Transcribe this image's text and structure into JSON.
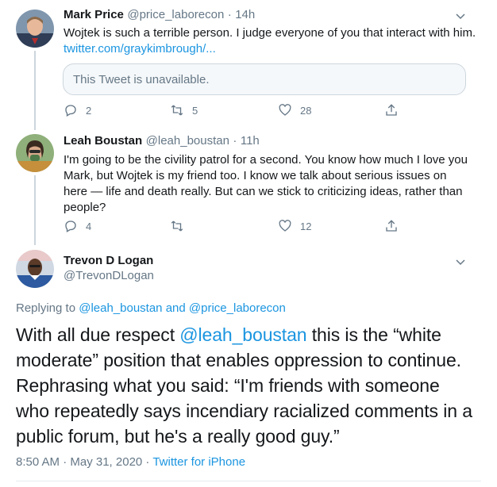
{
  "tweets": [
    {
      "name": "Mark Price",
      "handle": "@price_laborecon",
      "sep": "·",
      "time": "14h",
      "text": "Wojtek is such a terrible person. I judge everyone of you that interact with him.",
      "link": "twitter.com/graykimbrough/...",
      "quote_notice": "This Tweet is unavailable.",
      "replies": "2",
      "retweets": "5",
      "likes": "28"
    },
    {
      "name": "Leah Boustan",
      "handle": "@leah_boustan",
      "sep": "·",
      "time": "11h",
      "text": "I'm going to be the civility patrol for a second. You know how much I love you Mark, but Wojtek is my friend too. I know we talk about serious issues on here — life and death really. But can we stick to criticizing ideas, rather than people?",
      "replies": "4",
      "retweets": "",
      "likes": "12"
    }
  ],
  "main": {
    "name": "Trevon D Logan",
    "handle": "@TrevonDLogan",
    "replying_prefix": "Replying to",
    "replying_user1": "@leah_boustan",
    "replying_and": "and",
    "replying_user2": "@price_laborecon",
    "text_before": "With all due respect",
    "mention": "@leah_boustan",
    "text_after": "this is the “white moderate” position that enables oppression to continue. Rephrasing what you said: “I'm friends with someone who repeatedly says incendiary racialized comments in a public forum, but he's a really good guy.”",
    "time": "8:50 AM · May 31, 2020 ·",
    "source": "Twitter for iPhone"
  },
  "colors": {
    "link": "#1b95e0",
    "muted": "#657786",
    "line": "#ccd6dd"
  },
  "icons": [
    "reply-icon",
    "retweet-icon",
    "like-icon",
    "share-icon",
    "chevron-down-icon"
  ]
}
